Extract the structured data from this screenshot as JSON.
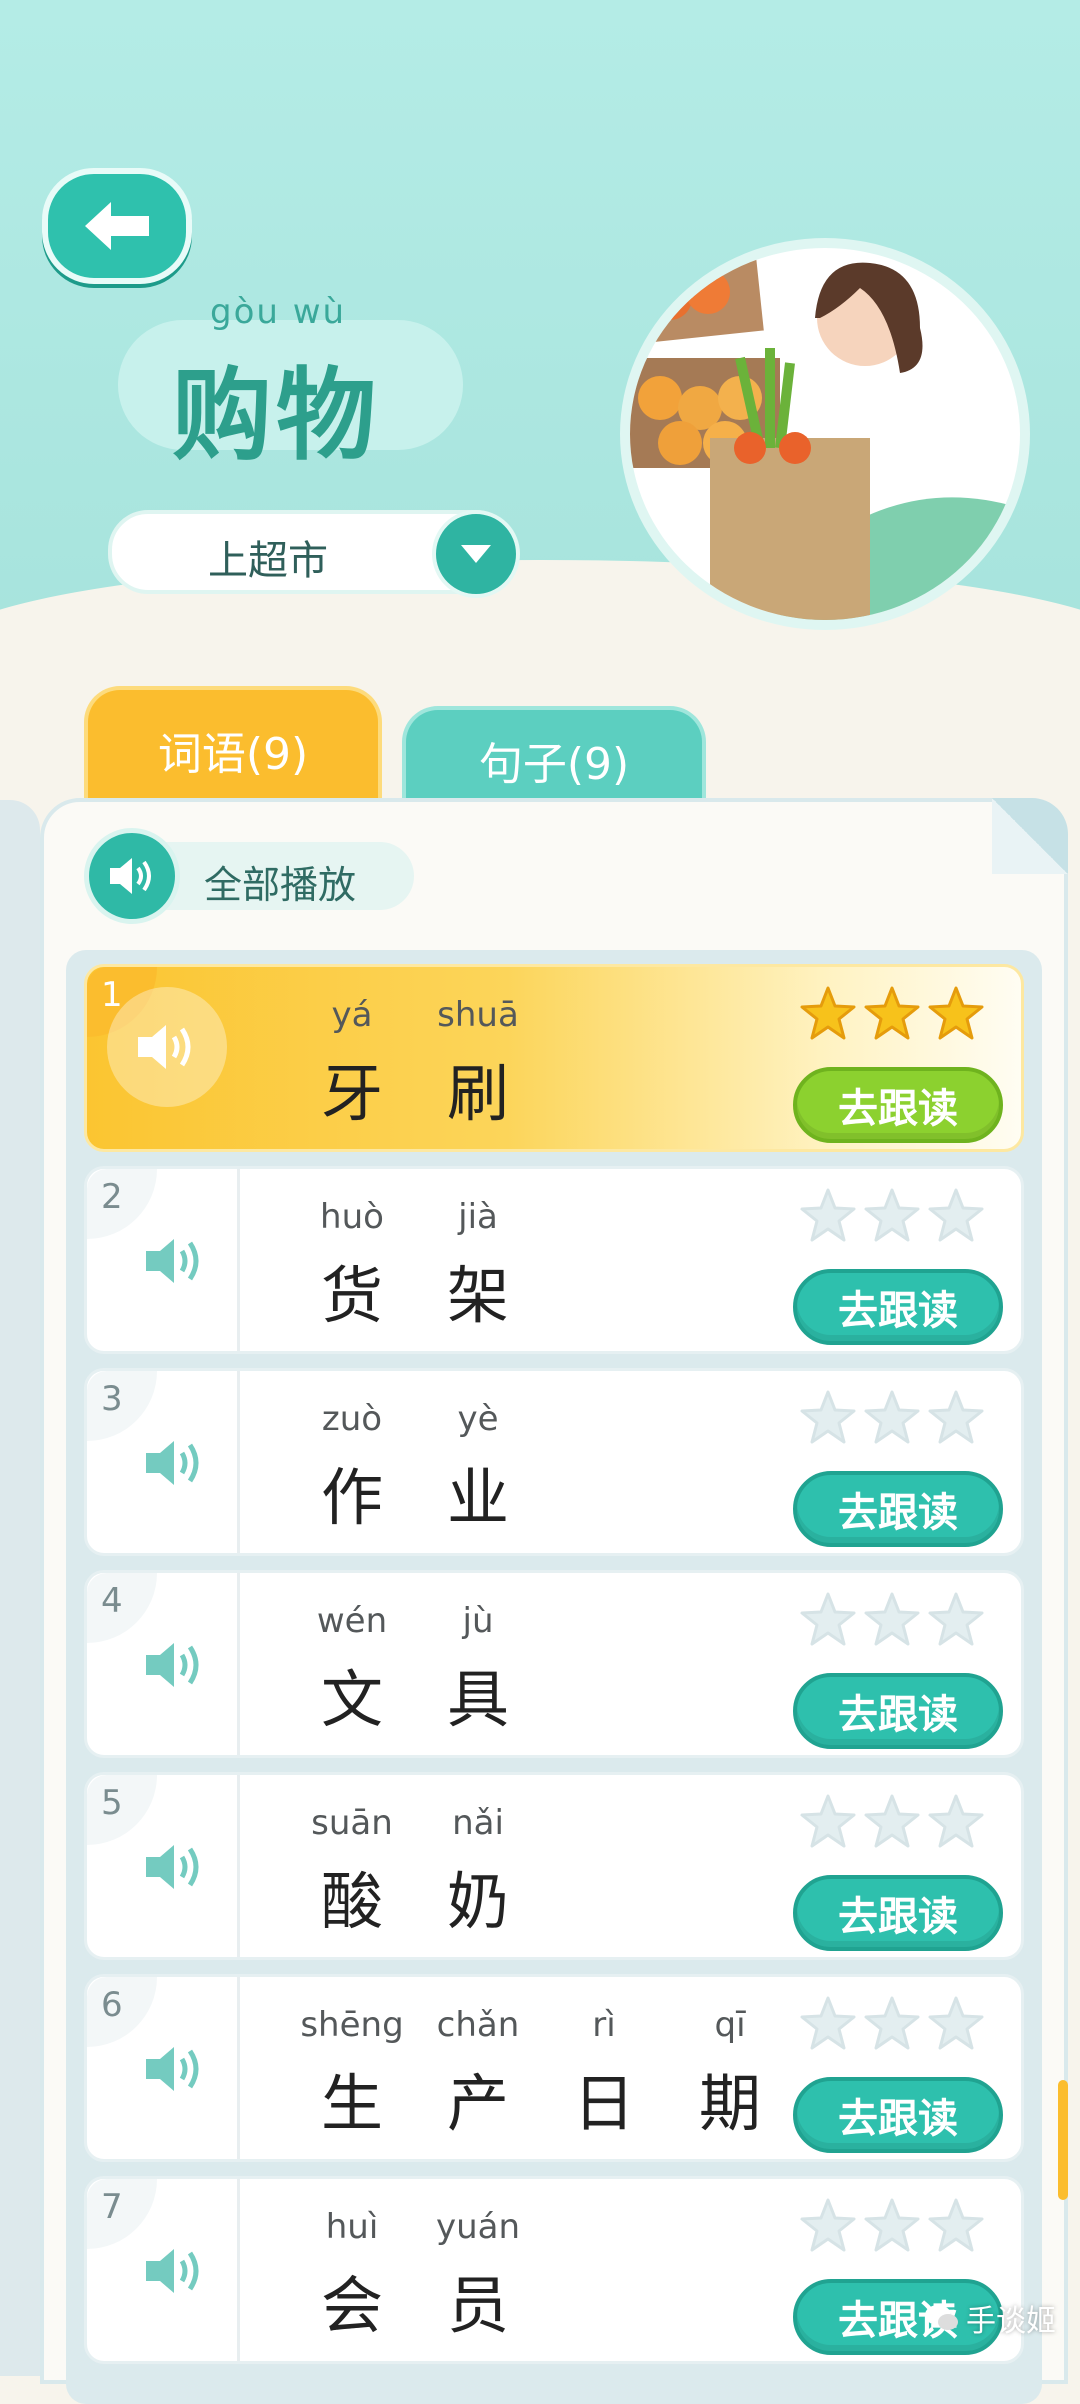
{
  "header": {
    "title_pinyin": "gòu wù",
    "title": "购物",
    "dropdown_value": "上超市"
  },
  "tabs": [
    {
      "label": "词语(9)",
      "active": true
    },
    {
      "label": "句子(9)",
      "active": false
    }
  ],
  "play_all_label": "全部播放",
  "rows": [
    {
      "num": "1",
      "syllables": [
        {
          "py": "yá",
          "hz": "牙"
        },
        {
          "py": "shuā",
          "hz": "刷"
        }
      ],
      "stars": 3,
      "button": "去跟读",
      "active": true
    },
    {
      "num": "2",
      "syllables": [
        {
          "py": "huò",
          "hz": "货"
        },
        {
          "py": "jià",
          "hz": "架"
        }
      ],
      "stars": 0,
      "button": "去跟读",
      "active": false
    },
    {
      "num": "3",
      "syllables": [
        {
          "py": "zuò",
          "hz": "作"
        },
        {
          "py": "yè",
          "hz": "业"
        }
      ],
      "stars": 0,
      "button": "去跟读",
      "active": false
    },
    {
      "num": "4",
      "syllables": [
        {
          "py": "wén",
          "hz": "文"
        },
        {
          "py": "jù",
          "hz": "具"
        }
      ],
      "stars": 0,
      "button": "去跟读",
      "active": false
    },
    {
      "num": "5",
      "syllables": [
        {
          "py": "suān",
          "hz": "酸"
        },
        {
          "py": "nǎi",
          "hz": "奶"
        }
      ],
      "stars": 0,
      "button": "去跟读",
      "active": false
    },
    {
      "num": "6",
      "syllables": [
        {
          "py": "shēng",
          "hz": "生"
        },
        {
          "py": "chǎn",
          "hz": "产"
        },
        {
          "py": "rì",
          "hz": "日"
        },
        {
          "py": "qī",
          "hz": "期"
        }
      ],
      "stars": 0,
      "button": "去跟读",
      "active": false
    },
    {
      "num": "7",
      "syllables": [
        {
          "py": "huì",
          "hz": "会"
        },
        {
          "py": "yuán",
          "hz": "员"
        }
      ],
      "stars": 0,
      "button": "去跟读",
      "active": false
    }
  ],
  "watermark": "手谈姬",
  "colors": {
    "accent": "#2fc1ad",
    "active_tab": "#fbbd2e",
    "star_on": "#f7c21b",
    "star_off": "#e3eef0",
    "active_button": "#8cd12f"
  },
  "icons": {
    "back": "arrow-left-icon",
    "dropdown": "chevron-down-icon",
    "speaker": "speaker-icon",
    "star": "star-icon"
  }
}
